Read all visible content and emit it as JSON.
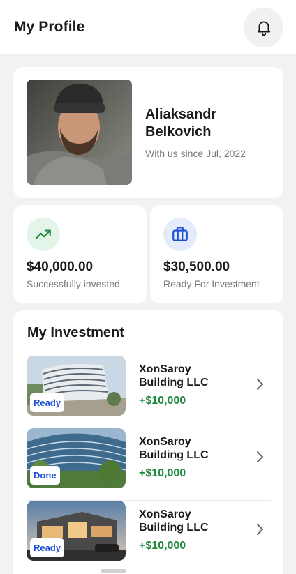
{
  "header": {
    "title": "My Profile",
    "bell_icon": "bell-icon"
  },
  "profile": {
    "name": "Aliaksandr Belkovich",
    "since": "With us since Jul, 2022"
  },
  "stats": [
    {
      "amount": "$40,000.00",
      "label": "Successfully invested",
      "icon": "trending-up-icon",
      "icon_bg": "#e3f5e8",
      "icon_color": "#1f8a3e"
    },
    {
      "amount": "$30,500.00",
      "label": "Ready For Investment",
      "icon": "briefcase-icon",
      "icon_bg": "#e4ebfb",
      "icon_color": "#1e4fd6"
    }
  ],
  "investment": {
    "title": "My Investment",
    "items": [
      {
        "name": "XonSaroy Building LLC",
        "amount": "+$10,000",
        "status": "Ready"
      },
      {
        "name": "XonSaroy Building LLC",
        "amount": "+$10,000",
        "status": "Done"
      },
      {
        "name": "XonSaroy Building LLC",
        "amount": "+$10,000",
        "status": "Ready"
      }
    ]
  },
  "colors": {
    "accent_green": "#1f8a3e",
    "accent_blue": "#1e4fd6",
    "background": "#f2f2f2"
  }
}
